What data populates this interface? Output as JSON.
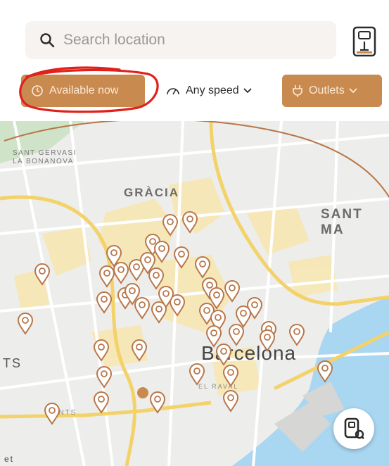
{
  "search": {
    "placeholder": "Search location",
    "icon": "search-icon"
  },
  "header": {
    "charger_icon": "charger-icon"
  },
  "filters": {
    "available": {
      "label": "Available now",
      "icon": "clock-icon"
    },
    "speed": {
      "label": "Any speed",
      "icon": "speedometer-icon"
    },
    "outlets": {
      "label": "Outlets",
      "icon": "plug-icon"
    }
  },
  "map": {
    "labels": {
      "sant_gervasi_1": "SANT GERVASI",
      "sant_gervasi_2": "LA BONANOVA",
      "gracia": "GRÀCIA",
      "sant_ma": "SANT MA",
      "barcelona": "Barcelona",
      "ts": "TS",
      "sants": "SANTS",
      "el_raval": "EL RAVAL",
      "et": "et"
    },
    "marker_count": 44
  },
  "colors": {
    "accent": "#c98a4f",
    "accent_text": "#fbe9d6",
    "annotation": "#e0201c",
    "radius_ring": "#b8774a"
  }
}
